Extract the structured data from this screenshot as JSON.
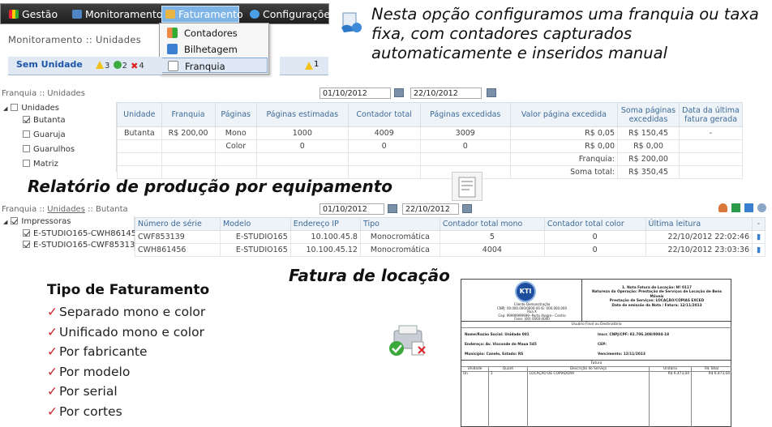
{
  "nav": {
    "items": [
      "Gestão",
      "Monitoramento",
      "Faturamento",
      "Configurações"
    ],
    "dropdown": [
      "Contadores",
      "Bilhetagem",
      "Franquia"
    ]
  },
  "monitoramento": {
    "breadcrumb": "Monitoramento :: Unidades",
    "row_label": "Sem Unidade",
    "warn_count": "3",
    "ok_count": "2",
    "err_count": "4",
    "right_count": "1"
  },
  "intro_text": "Nesta opção configuramos uma franquia ou taxa fixa, com contadores capturados automaticamente e inseridos manual",
  "franquia": {
    "breadcrumb": "Franquia :: Unidades",
    "date_from": "01/10/2012",
    "date_to": "22/10/2012",
    "tree_root": "Unidades",
    "tree_items": [
      "Butanta",
      "Guaruja",
      "Guarulhos",
      "Matriz"
    ],
    "columns": [
      "Unidade",
      "Franquia",
      "Páginas",
      "Páginas estimadas",
      "Contador total",
      "Páginas excedidas",
      "Valor página excedida",
      "Soma páginas excedidas",
      "Data da última fatura gerada"
    ],
    "rows": [
      [
        "Butanta",
        "R$ 200,00",
        "Mono",
        "1000",
        "4009",
        "3009",
        "R$ 0,05",
        "R$ 150,45",
        "-"
      ],
      [
        "",
        "",
        "Color",
        "0",
        "0",
        "0",
        "R$ 0,00",
        "R$ 0,00",
        ""
      ]
    ],
    "franquia_label": "Franquia:",
    "franquia_value": "R$ 200,00",
    "soma_label": "Soma total:",
    "soma_value": "R$ 350,45"
  },
  "relatorio_title": "Relatório de produção por equipamento",
  "producao": {
    "breadcrumb_prefix": "Franquia :: ",
    "breadcrumb_link": "Unidades",
    "breadcrumb_suffix": " :: Butanta",
    "date_from": "01/10/2012",
    "date_to": "22/10/2012",
    "tree_root": "Impressoras",
    "tree_items": [
      "E-STUDIO165-CWH86145",
      "E-STUDIO165-CWF85313"
    ],
    "columns": [
      "Número de série",
      "Modelo",
      "Endereço IP",
      "Tipo",
      "Contador total mono",
      "Contador total color",
      "Última leitura"
    ],
    "rows": [
      [
        "CWF853139",
        "E-STUDIO165",
        "10.100.45.8",
        "Monocromática",
        "5",
        "0",
        "22/10/2012 22:02:46"
      ],
      [
        "CWH861456",
        "E-STUDIO165",
        "10.100.45.12",
        "Monocromática",
        "4004",
        "0",
        "22/10/2012 23:03:36"
      ]
    ]
  },
  "fatura_title": "Fatura de locação",
  "tipo": {
    "heading": "Tipo de Faturamento",
    "items": [
      "Separado mono e color",
      "Unificado mono e color",
      "Por fabricante",
      "Por modelo",
      "Por serial",
      "Por cortes"
    ]
  },
  "invoice": {
    "logo": "KTI",
    "title_lines": [
      "1. Nota Fatura de Locação: Nº 0117",
      "Natureza da Operação: Prestação de Serviços de Locação de Bens Móveis",
      "Prestação de Serviços: LOCAÇÃO/CÓPIAS EXCED",
      "Data de emissão da Nota / Fatura: 12/11/2013"
    ],
    "company_lines": [
      "Cliente Demonstração",
      "CNPJ: 00.000.000/0000-00 IE: 000.000.000",
      "Rua X",
      "Cep: 99999999999--Porto Alegre-- Centro",
      "Fone: (00) 0000-0000"
    ],
    "section_title": "Usuário Final ou Destinatário",
    "fields_left": [
      "Nome/Razão Social: Unidade 001",
      "Endereço: Av. Visconde de Maua 545",
      "Município: Canelo, Estado: RS"
    ],
    "fields_right": [
      "Inscr. CNPJ/CPF: 92.706.308/0004-18",
      "CEP:",
      "Vencimento: 12/11/2013"
    ],
    "fatura_label": "Fatura",
    "columns": [
      "Unidade",
      "Quant",
      "Descrição do Serviço",
      "Unitário",
      "R$ Total"
    ],
    "row": [
      "Un",
      "1",
      "LOCAÇÃO DE COPIADORA",
      "R$ 6.473,04",
      "R$ 6.473,04"
    ]
  },
  "colors": {
    "nav_bg": "#2b2b2b",
    "nav_active": "#7eb4e6",
    "table_header": "#3d6a98",
    "check": "#d0262e"
  }
}
